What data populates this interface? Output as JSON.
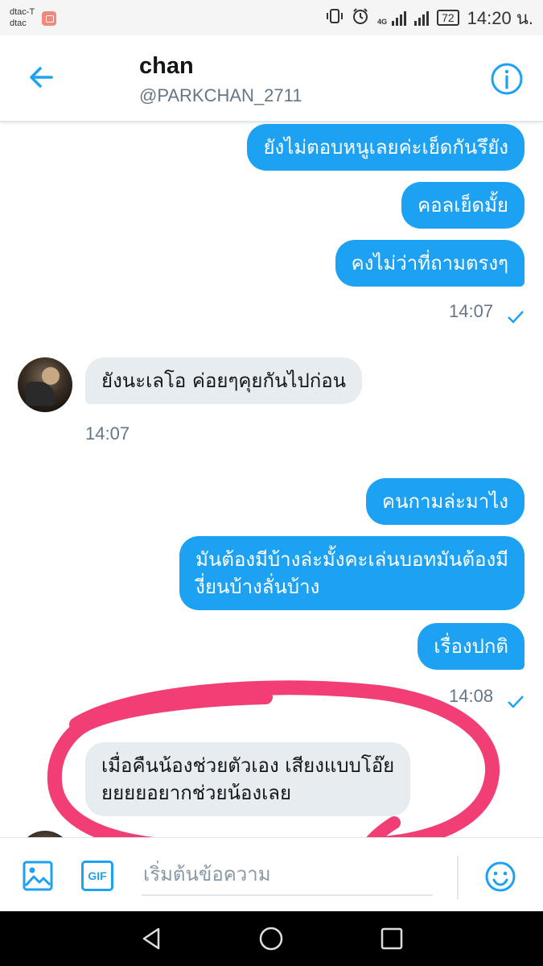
{
  "status_bar": {
    "carrier_1": "dtac-T",
    "carrier_2": "dtac",
    "network": "4G",
    "battery": "72",
    "time": "14:20 น."
  },
  "header": {
    "name": "chan",
    "handle": "@PARKCHAN_2711",
    "back_icon": "arrow-left-icon",
    "info_icon": "info-circle-icon"
  },
  "messages": {
    "out1": {
      "text": "ยังไม่ตอบหนูเลยค่ะเย็ดกันรึยัง"
    },
    "out2": {
      "text": "คอลเย็ดมั้ย"
    },
    "out3": {
      "text": "คงไม่ว่าที่ถามตรงๆ"
    },
    "time1": "14:07",
    "in1": {
      "text": "ยังนะเลโอ ค่อยๆคุยกันไปก่อน"
    },
    "time2": "14:07",
    "out4": {
      "text": "คนกามล่ะมาไง"
    },
    "out5": {
      "line1": "มันต้องมีบ้างล่ะมั้งคะเล่นบอทมันต้องมี",
      "line2": "งี่ยนบ้างลั่นบ้าง"
    },
    "out6": {
      "text": "เรื่องปกติ"
    },
    "time3": "14:08",
    "in2": {
      "line1": "เมื่อคืนน้องช่วยตัวเอง เสียงแบบโอ๊ย",
      "line2": "ยยยยอยากช่วยน้องเลย"
    }
  },
  "composer": {
    "placeholder": "เริ่มต้นข้อความ",
    "gif_label": "GIF",
    "image_icon": "image-icon",
    "emoji_icon": "emoji-icon"
  },
  "colors": {
    "accent": "#1da1f2",
    "incoming_bubble": "#e6ecf0",
    "annotation": "#f0356e"
  }
}
